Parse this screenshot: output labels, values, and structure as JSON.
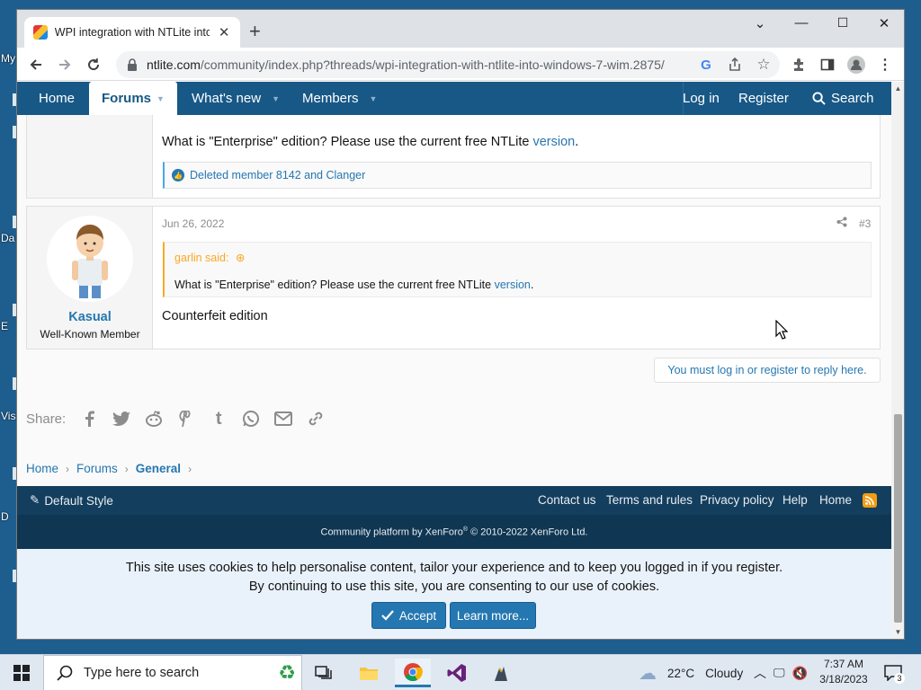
{
  "browser": {
    "tab_title": "WPI integration with NTLite into",
    "url_domain": "ntlite.com",
    "url_path": "/community/index.php?threads/wpi-integration-with-ntlite-into-windows-7-wim.2875/"
  },
  "desktop": {
    "labels": [
      "My",
      "Da",
      "E",
      "Vis",
      "D"
    ]
  },
  "forum_nav": {
    "home": "Home",
    "forums": "Forums",
    "whats_new": "What's new",
    "members": "Members",
    "login": "Log in",
    "register": "Register",
    "search": "Search"
  },
  "post1": {
    "text_before": "What is \"Enterprise\" edition? Please use the current free NTLite ",
    "link": "version",
    "text_after": ".",
    "reactions": "Deleted member 8142 and Clanger"
  },
  "post2": {
    "username": "Kasual",
    "user_title": "Well-Known Member",
    "date": "Jun 26, 2022",
    "number": "#3",
    "quote_author": "garlin said:",
    "quote_text_before": "What is \"Enterprise\" edition? Please use the current free NTLite ",
    "quote_link": "version",
    "quote_text_after": ".",
    "body": "Counterfeit edition"
  },
  "reply_prompt": "You must log in or register to reply here.",
  "share": {
    "label": "Share:",
    "icons": [
      "facebook-icon",
      "twitter-icon",
      "reddit-icon",
      "pinterest-icon",
      "tumblr-icon",
      "whatsapp-icon",
      "email-icon",
      "link-icon"
    ]
  },
  "breadcrumb": [
    "Home",
    "Forums",
    "General"
  ],
  "footer": {
    "style": "Default Style",
    "links": [
      "Contact us",
      "Terms and rules",
      "Privacy policy",
      "Help",
      "Home"
    ],
    "copyright_pre": "Community platform by XenForo",
    "copyright_sup": "®",
    "copyright_post": " © 2010-2022 XenForo Ltd."
  },
  "cookie": {
    "line1": "This site uses cookies to help personalise content, tailor your experience and to keep you logged in if you register.",
    "line2": "By continuing to use this site, you are consenting to our use of cookies.",
    "accept": "Accept",
    "learn_more": "Learn more..."
  },
  "taskbar": {
    "search_placeholder": "Type here to search",
    "weather_temp": "22°C",
    "weather_desc": "Cloudy",
    "time": "7:37 AM",
    "date": "3/18/2023",
    "notification_count": "3"
  },
  "colors": {
    "nav_bg": "#185886",
    "link": "#2577b1",
    "quote_accent": "#f9a825",
    "footer_bg": "#0f3652",
    "cookie_bg": "#e9f2fb"
  }
}
